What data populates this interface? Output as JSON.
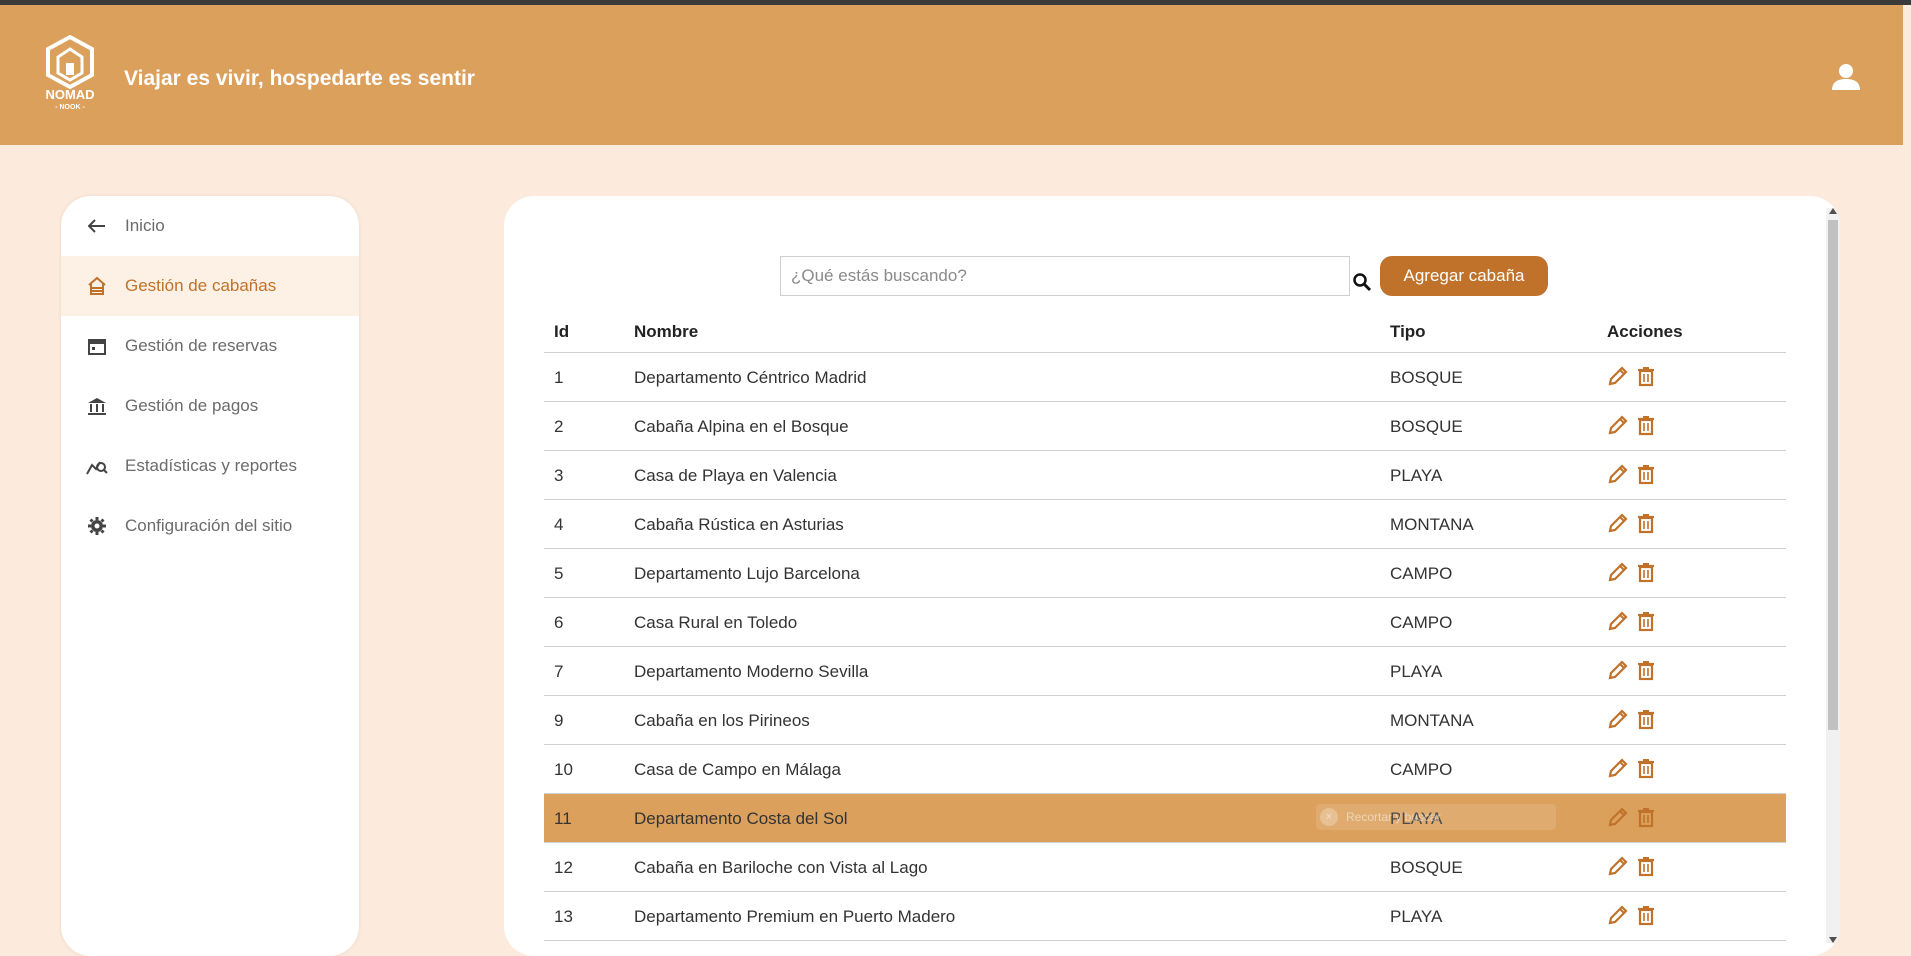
{
  "header": {
    "logo_text": "NOMAD",
    "logo_sub": "NOOK",
    "tagline": "Viajar es vivir, hospedarte es sentir",
    "user_icon": "user-icon"
  },
  "sidebar": {
    "items": [
      {
        "label": "Inicio",
        "icon": "arrow-left-icon"
      },
      {
        "label": "Gestión de cabañas",
        "icon": "cabin-icon"
      },
      {
        "label": "Gestión de reservas",
        "icon": "calendar-icon"
      },
      {
        "label": "Gestión de pagos",
        "icon": "bank-icon"
      },
      {
        "label": "Estadísticas y reportes",
        "icon": "chart-search-icon"
      },
      {
        "label": "Configuración del sitio",
        "icon": "gear-icon"
      }
    ]
  },
  "toolbar": {
    "search_placeholder": "¿Qué estás buscando?",
    "add_label": "Agregar cabaña"
  },
  "table": {
    "headers": [
      "Id",
      "Nombre",
      "Tipo",
      "Acciones"
    ],
    "rows": [
      {
        "id": "1",
        "name": "Departamento Céntrico Madrid",
        "type": "BOSQUE"
      },
      {
        "id": "2",
        "name": "Cabaña Alpina en el Bosque",
        "type": "BOSQUE"
      },
      {
        "id": "3",
        "name": "Casa de Playa en Valencia",
        "type": "PLAYA"
      },
      {
        "id": "4",
        "name": "Cabaña Rústica en Asturias",
        "type": "MONTANA"
      },
      {
        "id": "5",
        "name": "Departamento Lujo Barcelona",
        "type": "CAMPO"
      },
      {
        "id": "6",
        "name": "Casa Rural en Toledo",
        "type": "CAMPO"
      },
      {
        "id": "7",
        "name": "Departamento Moderno Sevilla",
        "type": "PLAYA"
      },
      {
        "id": "9",
        "name": "Cabaña en los Pirineos",
        "type": "MONTANA"
      },
      {
        "id": "10",
        "name": "Casa de Campo en Málaga",
        "type": "CAMPO"
      },
      {
        "id": "11",
        "name": "Departamento Costa del Sol",
        "type": "PLAYA"
      },
      {
        "id": "12",
        "name": "Cabaña en Bariloche con Vista al Lago",
        "type": "BOSQUE"
      },
      {
        "id": "13",
        "name": "Departamento Premium en Puerto Madero",
        "type": "PLAYA"
      }
    ],
    "tooltip_text": "Recortar y buscar"
  },
  "colors": {
    "header_bg": "#dba05c",
    "accent": "#c0722a",
    "page_bg": "#fcebdc",
    "highlight_row": "#dba05c"
  }
}
